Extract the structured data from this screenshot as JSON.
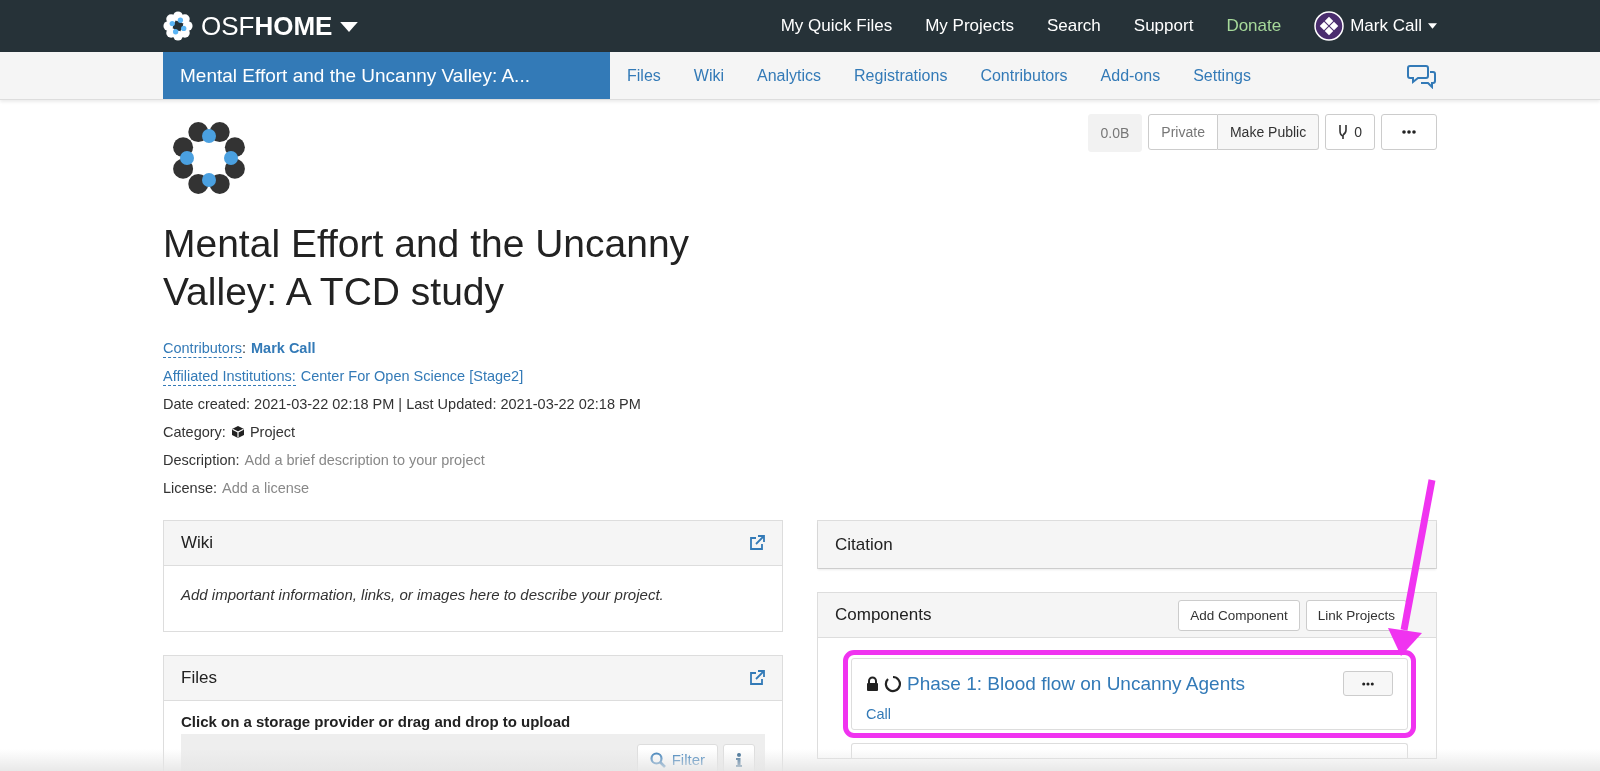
{
  "navbar": {
    "brand_light": "OSF",
    "brand_bold": "HOME",
    "links": [
      {
        "label": "My Quick Files",
        "kind": "link"
      },
      {
        "label": "My Projects",
        "kind": "link"
      },
      {
        "label": "Search",
        "kind": "link"
      },
      {
        "label": "Support",
        "kind": "link"
      },
      {
        "label": "Donate",
        "kind": "donate"
      }
    ],
    "user": "Mark Call"
  },
  "project_nav": {
    "title": "Mental Effort and the Uncanny Valley: A...",
    "links": [
      "Files",
      "Wiki",
      "Analytics",
      "Registrations",
      "Contributors",
      "Add-ons",
      "Settings"
    ]
  },
  "header_buttons": {
    "storage": "0.0B",
    "privacy": "Private",
    "make_public": "Make Public",
    "forks": "0"
  },
  "project": {
    "title": "Mental Effort and the Uncanny Valley: A TCD study",
    "contributors_label": "Contributors",
    "separator": ":",
    "contributors": "Mark Call",
    "affiliated_label": "Affiliated Institutions:",
    "affiliated": "Center For Open Science [Stage2]",
    "dates": "Date created: 2021-03-22 02:18 PM | Last Updated: 2021-03-22 02:18 PM",
    "category_label": "Category:",
    "category": "Project",
    "description_label": "Description:",
    "description": "Add a brief description to your project",
    "license_label": "License:",
    "license": "Add a license"
  },
  "wiki": {
    "title": "Wiki",
    "body": "Add important information, links, or images here to describe your project."
  },
  "files": {
    "title": "Files",
    "hint": "Click on a storage provider or drag and drop to upload",
    "filter": "Filter"
  },
  "citation": {
    "title": "Citation"
  },
  "components": {
    "title": "Components",
    "buttons": [
      "Add Component",
      "Link Projects"
    ],
    "items": [
      {
        "title": "Phase 1: Blood flow on Uncanny Agents",
        "contributor": "Call",
        "private": true,
        "highlighted": true
      }
    ]
  }
}
